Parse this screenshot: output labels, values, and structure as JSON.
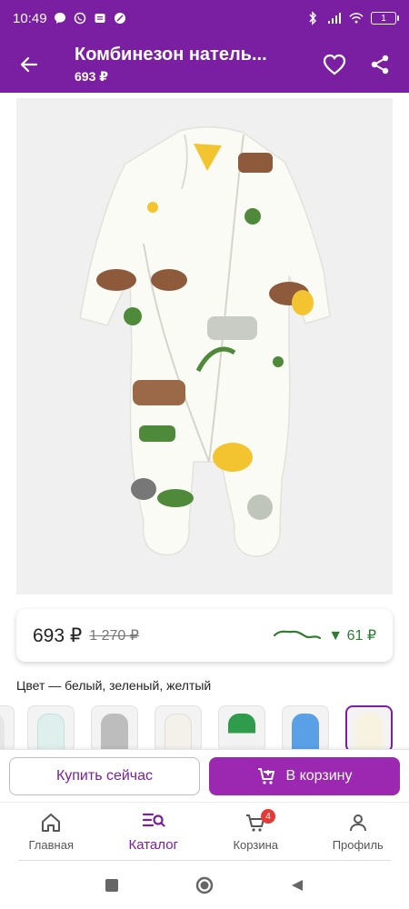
{
  "status_bar": {
    "time": "10:49",
    "battery": "1"
  },
  "app_bar": {
    "title": "Комбинезон натель...",
    "subtitle": "693 ₽"
  },
  "price_card": {
    "price": "693 ₽",
    "old_price": "1 270 ₽",
    "drop": "▼ 61 ₽"
  },
  "color": {
    "label": "Цвет — белый, зеленый, желтый",
    "selected_index": 6
  },
  "actions": {
    "buy_now": "Купить сейчас",
    "add_to_cart": "В корзину"
  },
  "bottom_nav": {
    "items": [
      {
        "label": "Главная",
        "icon": "home-icon"
      },
      {
        "label": "Каталог",
        "icon": "catalog-search-icon"
      },
      {
        "label": "Корзина",
        "icon": "cart-icon",
        "badge": "4"
      },
      {
        "label": "Профиль",
        "icon": "profile-icon"
      }
    ]
  },
  "colors": {
    "brand": "#7b1fa2",
    "accent": "#9c27b0",
    "price_drop": "#2e7d32",
    "badge": "#e53935"
  }
}
